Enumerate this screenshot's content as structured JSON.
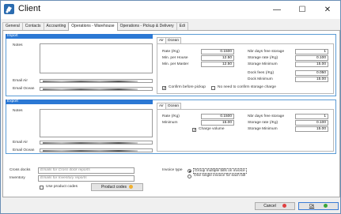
{
  "window": {
    "title": "Client",
    "minimize": "—",
    "maximize": "☐",
    "close": "✕"
  },
  "tabs": [
    "General",
    "Contacts",
    "Accounting",
    "Operations - Warehouse",
    "Operations - Pickup & Delivery",
    "Edi"
  ],
  "import": {
    "header": "Import",
    "notes_label": "Notes",
    "email_air_label": "Email Air",
    "email_ocean_label": "Email Ocean",
    "subtabs": [
      "Air",
      "Ocean"
    ],
    "rate_label": "Rate (/Kg)",
    "rate": "0.1500",
    "min_house_label": "Min. per House",
    "min_house": "12.50",
    "min_master_label": "Min. per Master",
    "min_master": "12.50",
    "free_days_label": "Nbr days free storage",
    "free_days": "1",
    "storage_rate_label": "Storage rate (/Kg)",
    "storage_rate": "0.100",
    "storage_min_label": "Storage Minimum",
    "storage_min": "15.00",
    "dock_fees_label": "Dock fees (/Kg)",
    "dock_fees": "0.050",
    "dock_min_label": "Dock Minimum",
    "dock_min": "15.00",
    "confirm_pickup": "Confirm before pickup",
    "no_confirm_storage": "No need to confirm storage charge"
  },
  "export": {
    "header": "Export",
    "notes_label": "Notes",
    "email_air_label": "Email Air",
    "email_ocean_label": "Email Ocean",
    "subtabs": [
      "Air",
      "Ocean"
    ],
    "rate_label": "Rate (/Kg)",
    "rate": "0.1500",
    "min_label": "Minimum",
    "min": "15.00",
    "charge_volume": "Charge volume",
    "free_days_label": "Nbr days free storage",
    "free_days": "1",
    "storage_rate_label": "Storage rate (/Kg)",
    "storage_rate": "0.100",
    "storage_min_label": "Storage Minimum",
    "storage_min": "15.00"
  },
  "bottom": {
    "cross_docks_label": "Cross docks",
    "cross_docks_placeholder": "Emails for Cross dock reports",
    "inventory_label": "Inventory",
    "inventory_placeholder": "Emails for Inventory reports",
    "use_product_codes": "Use product codes",
    "product_codes_button": "Product codes",
    "invoice_type_label": "Invoice type",
    "invoice_option_1": "Group multiple bills on invoice",
    "invoice_option_2": "One single invoice for each bill"
  },
  "footer": {
    "cancel": "Cancel",
    "ok": "Ok"
  },
  "colors": {
    "accent": "#2b78d4",
    "cancel_red": "#e04040",
    "ok_green": "#3aa63a",
    "product_orange": "#f0b030"
  }
}
